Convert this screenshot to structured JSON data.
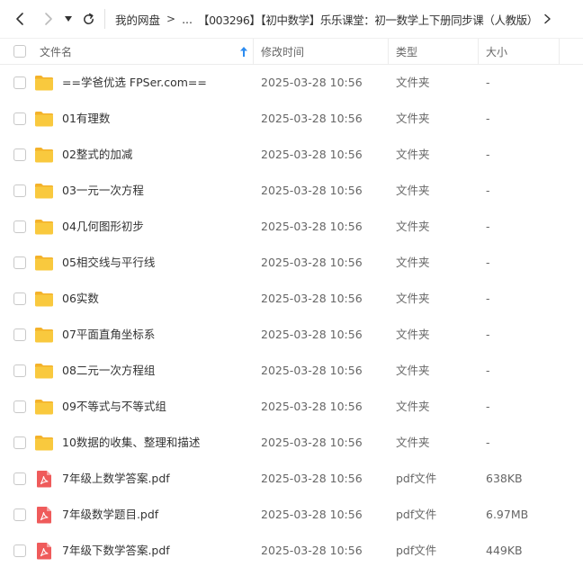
{
  "toolbar": {
    "back_icon": "chevron-left-icon",
    "forward_icon": "chevron-right-icon",
    "dropdown_icon": "caret-down-icon",
    "refresh_icon": "refresh-icon"
  },
  "breadcrumb": {
    "root": "我的网盘",
    "sep": ">",
    "ellipsis": "...",
    "current": "【003296】【初中数学】乐乐课堂：初一数学上下册同步课（人教版）",
    "more": ">"
  },
  "header": {
    "name": "文件名",
    "modified": "修改时间",
    "type": "类型",
    "size": "大小",
    "sort_icon": "sort-ascending-icon"
  },
  "colors": {
    "folder": "#f7c23b",
    "folder_tab": "#f4b22a",
    "pdf": "#ee5a5a",
    "sort_arrow": "#2d8cf0"
  },
  "files": [
    {
      "name": "==学爸优选 FPSer.com==",
      "modified": "2025-03-28 10:56",
      "type": "文件夹",
      "size": "-",
      "icon": "folder-icon"
    },
    {
      "name": "01有理数",
      "modified": "2025-03-28 10:56",
      "type": "文件夹",
      "size": "-",
      "icon": "folder-icon"
    },
    {
      "name": "02整式的加减",
      "modified": "2025-03-28 10:56",
      "type": "文件夹",
      "size": "-",
      "icon": "folder-icon"
    },
    {
      "name": "03一元一次方程",
      "modified": "2025-03-28 10:56",
      "type": "文件夹",
      "size": "-",
      "icon": "folder-icon"
    },
    {
      "name": "04几何图形初步",
      "modified": "2025-03-28 10:56",
      "type": "文件夹",
      "size": "-",
      "icon": "folder-icon"
    },
    {
      "name": "05相交线与平行线",
      "modified": "2025-03-28 10:56",
      "type": "文件夹",
      "size": "-",
      "icon": "folder-icon"
    },
    {
      "name": "06实数",
      "modified": "2025-03-28 10:56",
      "type": "文件夹",
      "size": "-",
      "icon": "folder-icon"
    },
    {
      "name": "07平面直角坐标系",
      "modified": "2025-03-28 10:56",
      "type": "文件夹",
      "size": "-",
      "icon": "folder-icon"
    },
    {
      "name": "08二元一次方程组",
      "modified": "2025-03-28 10:56",
      "type": "文件夹",
      "size": "-",
      "icon": "folder-icon"
    },
    {
      "name": "09不等式与不等式组",
      "modified": "2025-03-28 10:56",
      "type": "文件夹",
      "size": "-",
      "icon": "folder-icon"
    },
    {
      "name": "10数据的收集、整理和描述",
      "modified": "2025-03-28 10:56",
      "type": "文件夹",
      "size": "-",
      "icon": "folder-icon"
    },
    {
      "name": "7年级上数学答案.pdf",
      "modified": "2025-03-28 10:56",
      "type": "pdf文件",
      "size": "638KB",
      "icon": "pdf-icon"
    },
    {
      "name": "7年级数学题目.pdf",
      "modified": "2025-03-28 10:56",
      "type": "pdf文件",
      "size": "6.97MB",
      "icon": "pdf-icon"
    },
    {
      "name": "7年级下数学答案.pdf",
      "modified": "2025-03-28 10:56",
      "type": "pdf文件",
      "size": "449KB",
      "icon": "pdf-icon"
    }
  ]
}
